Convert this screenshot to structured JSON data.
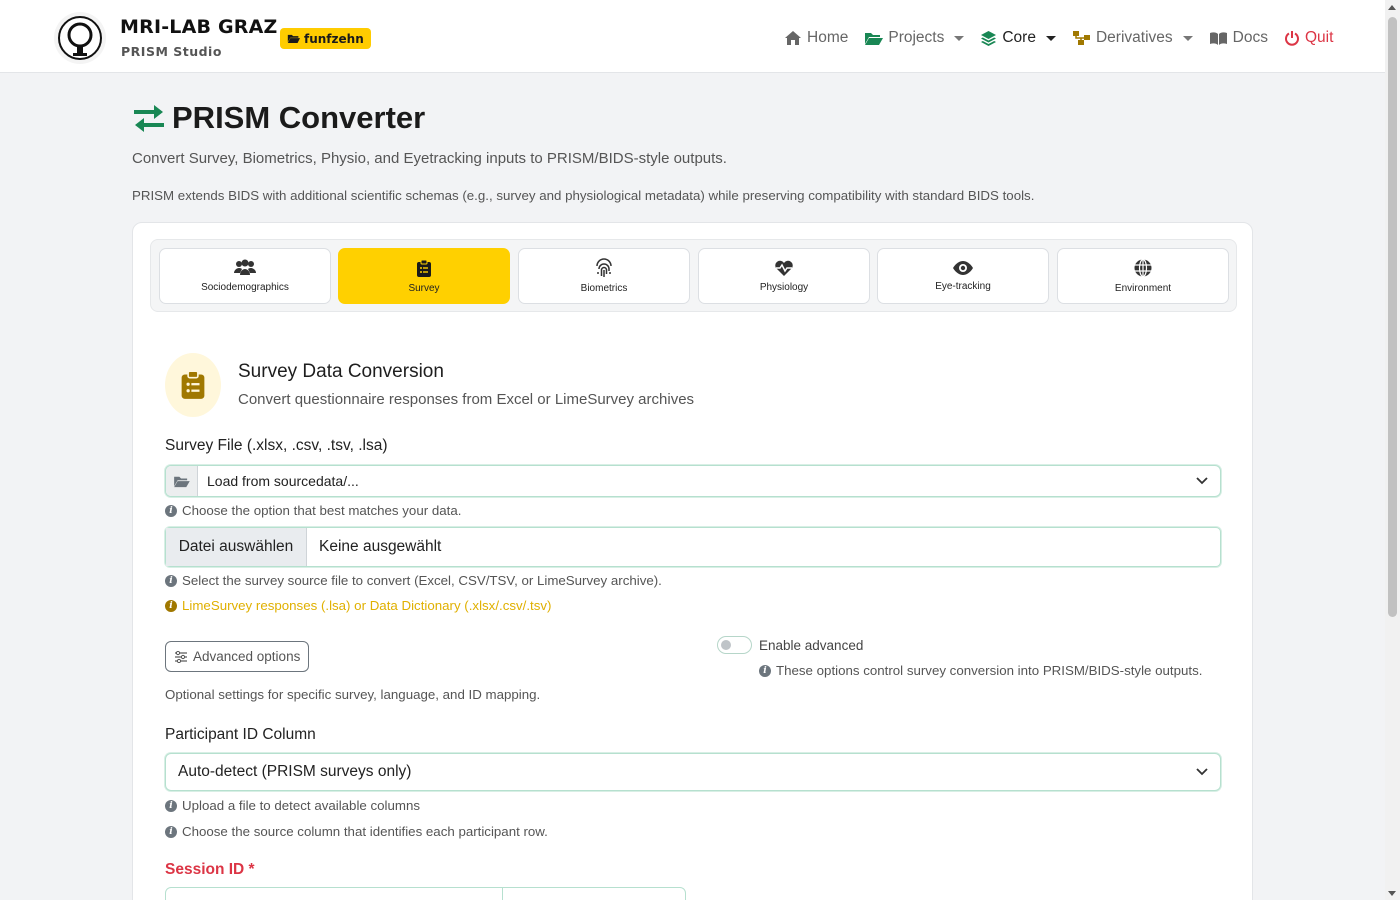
{
  "navbar": {
    "brand_title": "MRI-LAB GRAZ",
    "brand_subtitle": "PRISM Studio",
    "project_badge": "funfzehn",
    "links": [
      {
        "label": "Home",
        "icon": "home-icon"
      },
      {
        "label": "Projects",
        "icon": "folder-open-icon",
        "dropdown": true
      },
      {
        "label": "Core",
        "icon": "layers-icon",
        "dropdown": true,
        "active": true
      },
      {
        "label": "Derivatives",
        "icon": "sitemap-icon",
        "dropdown": true
      },
      {
        "label": "Docs",
        "icon": "book-icon"
      },
      {
        "label": "Quit",
        "icon": "power-icon"
      }
    ]
  },
  "header": {
    "title": "PRISM Converter",
    "subtitle": "Convert Survey, Biometrics, Physio, and Eyetracking inputs to PRISM/BIDS-style outputs.",
    "intro": "PRISM extends BIDS with additional scientific schemas (e.g., survey and physiological metadata) while preserving compatibility with standard BIDS tools."
  },
  "tabs": [
    {
      "label": "Sociodemographics",
      "icon": "users-icon"
    },
    {
      "label": "Survey",
      "icon": "clipboard-list-icon",
      "active": true
    },
    {
      "label": "Biometrics",
      "icon": "fingerprint-icon"
    },
    {
      "label": "Physiology",
      "icon": "heart-pulse-icon"
    },
    {
      "label": "Eye-tracking",
      "icon": "eye-icon"
    },
    {
      "label": "Environment",
      "icon": "globe-icon"
    }
  ],
  "survey": {
    "title": "Survey Data Conversion",
    "subtitle": "Convert questionnaire responses from Excel or LimeSurvey archives",
    "file_label": "Survey File (.xlsx, .csv, .tsv, .lsa)",
    "source_select": "Load from sourcedata/...",
    "source_hint": "Choose the option that best matches your data.",
    "file_button": "Datei auswählen",
    "file_status": "Keine ausgewählt",
    "file_hint": "Select the survey source file to convert (Excel, CSV/TSV, or LimeSurvey archive).",
    "file_warning": "LimeSurvey responses (.lsa) or Data Dictionary (.xlsx/.csv/.tsv)",
    "advanced_button": "Advanced options",
    "advanced_toggle_label": "Enable advanced",
    "advanced_hint": "These options control survey conversion into PRISM/BIDS-style outputs.",
    "optional_text": "Optional settings for specific survey, language, and ID mapping.",
    "participant_label": "Participant ID Column",
    "participant_select": "Auto-detect (PRISM surveys only)",
    "participant_hint_1": "Upload a file to detect available columns",
    "participant_hint_2": "Choose the source column that identifies each participant row.",
    "session_label": "Session ID *"
  },
  "colors": {
    "accent": "#ffd000",
    "primary_green": "#198754",
    "danger": "#dc3545",
    "warning_text": "#e0b000"
  }
}
